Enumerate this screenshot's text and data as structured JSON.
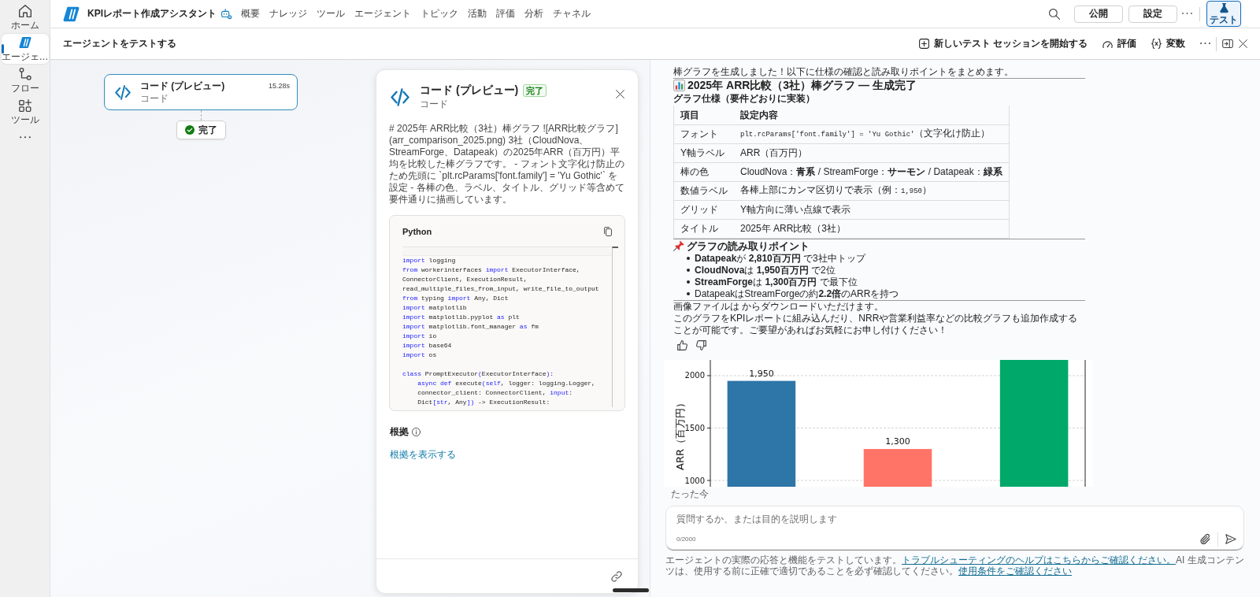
{
  "rail": {
    "items": [
      {
        "label": "ホーム",
        "selected": false
      },
      {
        "label": "エージェ…",
        "selected": true
      },
      {
        "label": "フロー",
        "selected": false
      },
      {
        "label": "ツール",
        "selected": false
      }
    ]
  },
  "topbar": {
    "title": "KPIレポート作成アシスタント",
    "tabs": [
      {
        "label": "概要",
        "selected": false
      },
      {
        "label": "ナレッジ",
        "selected": false
      },
      {
        "label": "ツール",
        "selected": false
      },
      {
        "label": "エージェント",
        "selected": false
      },
      {
        "label": "トピック",
        "selected": false
      },
      {
        "label": "活動",
        "selected": false
      },
      {
        "label": "評価",
        "selected": false
      },
      {
        "label": "分析",
        "selected": false
      },
      {
        "label": "チャネル",
        "selected": false
      }
    ],
    "buttons": [
      "公開",
      "設定"
    ],
    "test_button": {
      "label": "テスト",
      "selected": true
    }
  },
  "test_bar": {
    "title": "エージェントをテストする",
    "actions": [
      "新しいテスト セッションを開始する",
      "評価",
      "変数"
    ]
  },
  "flow": {
    "node": {
      "title": "コード (プレビュー)",
      "subtitle": "コード",
      "duration": "15.28s",
      "selected": true
    },
    "status": "完了"
  },
  "detail": {
    "title": "コード (プレビュー)",
    "badge": "完了",
    "subtitle": "コード",
    "description": "# 2025年 ARR比較（3社）棒グラフ ![ARR比較グラフ](arr_comparison_2025.png) 3社（CloudNova、StreamForge、Datapeak）の2025年ARR（百万円）平均を比較した棒グラフです。 - フォント文字化け防止のため先頭に `plt.rcParams['font.family'] = 'Yu Gothic'` を設定 - 各棒の色、ラベル、タイトル、グリッド等含めて要件通りに描画しています。",
    "code": {
      "language": "Python",
      "lines": [
        {
          "kind": "code",
          "tokens": [
            {
              "kind": "keyword",
              "text": "import"
            },
            {
              "kind": "plain",
              "text": " logging"
            }
          ]
        },
        {
          "kind": "code",
          "tokens": [
            {
              "kind": "keyword",
              "text": "from"
            },
            {
              "kind": "plain",
              "text": " workerinterfaces "
            },
            {
              "kind": "keyword",
              "text": "import"
            },
            {
              "kind": "plain",
              "text": " ExecutorInterface,"
            }
          ]
        },
        {
          "kind": "code",
          "tokens": [
            {
              "kind": "plain",
              "text": "ConnectorClient, ExecutionResult,"
            }
          ]
        },
        {
          "kind": "code",
          "tokens": [
            {
              "kind": "plain",
              "text": "read_multiple_files_from_input, write_file_to_output"
            }
          ]
        },
        {
          "kind": "code",
          "tokens": [
            {
              "kind": "keyword",
              "text": "from"
            },
            {
              "kind": "plain",
              "text": " typing "
            },
            {
              "kind": "keyword",
              "text": "import"
            },
            {
              "kind": "plain",
              "text": " Any, Dict"
            }
          ]
        },
        {
          "kind": "code",
          "tokens": [
            {
              "kind": "keyword",
              "text": "import"
            },
            {
              "kind": "plain",
              "text": " matplotlib"
            }
          ]
        },
        {
          "kind": "code",
          "tokens": [
            {
              "kind": "keyword",
              "text": "import"
            },
            {
              "kind": "plain",
              "text": " matplotlib.pyplot "
            },
            {
              "kind": "keyword",
              "text": "as"
            },
            {
              "kind": "plain",
              "text": " plt"
            }
          ]
        },
        {
          "kind": "code",
          "tokens": [
            {
              "kind": "keyword",
              "text": "import"
            },
            {
              "kind": "plain",
              "text": " matplotlib.font_manager "
            },
            {
              "kind": "keyword",
              "text": "as"
            },
            {
              "kind": "plain",
              "text": " fm"
            }
          ]
        },
        {
          "kind": "code",
          "tokens": [
            {
              "kind": "keyword",
              "text": "import"
            },
            {
              "kind": "plain",
              "text": " io"
            }
          ]
        },
        {
          "kind": "code",
          "tokens": [
            {
              "kind": "keyword",
              "text": "import"
            },
            {
              "kind": "plain",
              "text": " base64"
            }
          ]
        },
        {
          "kind": "code",
          "tokens": [
            {
              "kind": "keyword",
              "text": "import"
            },
            {
              "kind": "plain",
              "text": " os"
            }
          ]
        },
        {
          "kind": "blank"
        },
        {
          "kind": "code",
          "tokens": [
            {
              "kind": "keyword",
              "text": "class"
            },
            {
              "kind": "plain",
              "text": " PromptExecutor"
            },
            {
              "kind": "keyword",
              "text": "("
            },
            {
              "kind": "plain",
              "text": "ExecutorInterface"
            },
            {
              "kind": "keyword",
              "text": ")"
            },
            {
              "kind": "plain",
              "text": ":"
            }
          ]
        },
        {
          "kind": "code",
          "tokens": [
            {
              "kind": "keyword",
              "text": "    async"
            },
            {
              "kind": "keyword",
              "text": " def"
            },
            {
              "kind": "plain",
              "text": " execute"
            },
            {
              "kind": "keyword",
              "text": "(self"
            },
            {
              "kind": "plain",
              "text": ", logger: logging.Logger,"
            }
          ]
        },
        {
          "kind": "code",
          "tokens": [
            {
              "kind": "plain",
              "text": "    connector_client: ConnectorClient, "
            },
            {
              "kind": "keyword",
              "text": "input"
            },
            {
              "kind": "plain",
              "text": ":"
            }
          ]
        },
        {
          "kind": "code",
          "tokens": [
            {
              "kind": "plain",
              "text": "    Dict"
            },
            {
              "kind": "keyword",
              "text": "[str"
            },
            {
              "kind": "plain",
              "text": ", Any"
            },
            {
              "kind": "keyword",
              "text": "])"
            },
            {
              "kind": "plain",
              "text": " -> ExecutionResult:"
            }
          ]
        }
      ]
    },
    "grounding": {
      "heading": "根拠",
      "link": "根拠を表示する"
    }
  },
  "chat": {
    "intro": "棒グラフを生成しました！以下に仕様の確認と読み取りポイントをまとめます。",
    "heading": "2025年 ARR比較（3社）棒グラフ — 生成完了",
    "spec_heading": "グラフ仕様（要件どおりに実装）",
    "spec_table": {
      "columns": [
        "項目",
        "設定内容"
      ],
      "rows": [
        [
          "フォント",
          [
            {
              "kind": "code",
              "text": "plt.rcParams['font.family'] = 'Yu Gothic'"
            },
            {
              "kind": "text",
              "text": "（文字化け防止）"
            }
          ]
        ],
        [
          "Y軸ラベル",
          "ARR（百万円）"
        ],
        [
          "棒の色",
          "CloudNova：**青系** / StreamForge：**サーモン** / Datapeak：**緑系**"
        ],
        [
          "数値ラベル",
          [
            {
              "kind": "text",
              "text": "各棒上部にカンマ区切りで表示（例："
            },
            {
              "kind": "code",
              "text": "1,950"
            },
            {
              "kind": "text",
              "text": "）"
            }
          ]
        ],
        [
          "グリッド",
          "Y軸方向に薄い点線で表示"
        ],
        [
          "タイトル",
          "2025年 ARR比較（3社）"
        ]
      ]
    },
    "points_heading": "グラフの読み取りポイント",
    "points": [
      "**Datapeak**が **2,810百万円** で3社中トップ",
      "**CloudNova**は **1,950百万円** で2位",
      "**StreamForge**は **1,300百万円** で最下位",
      "DatapeakはStreamForgeの約**2.2倍**のARRを持つ"
    ],
    "download_note": "画像ファイルは からダウンロードいただけます。",
    "closing": "このグラフをKPIレポートに組み込んだり、NRRや営業利益率などの比較グラフも追加作成することが可能です。ご要望があればお気軽にお申し付けください！",
    "chart_data": {
      "type": "bar",
      "ylabel": "ARR（百万円）",
      "values": [
        1950,
        1300,
        2150
      ],
      "colors": [
        "#2e75a8",
        "#ff7466",
        "#00a86a"
      ],
      "ylim": [
        940,
        2150
      ],
      "yticks": [
        1000,
        1500,
        2000
      ],
      "grid": true,
      "value_labels": [
        "1,950",
        "1,300",
        null
      ]
    },
    "timestamp": "たった今",
    "composer": {
      "placeholder": "質問するか、または目的を説明します",
      "counter": "0/2000"
    },
    "disclaimer": [
      {
        "kind": "text",
        "text": "エージェントの実際の応答と機能をテストしています。"
      },
      {
        "kind": "link",
        "text": "トラブルシューティングのヘルプはこちらからご確認ください。"
      },
      {
        "kind": "text",
        "text": "AI 生成コンテンツは、使用する前に正確で適切であることを必ず確認してください。"
      },
      {
        "kind": "link",
        "text": "使用条件をご確認ください"
      }
    ]
  }
}
